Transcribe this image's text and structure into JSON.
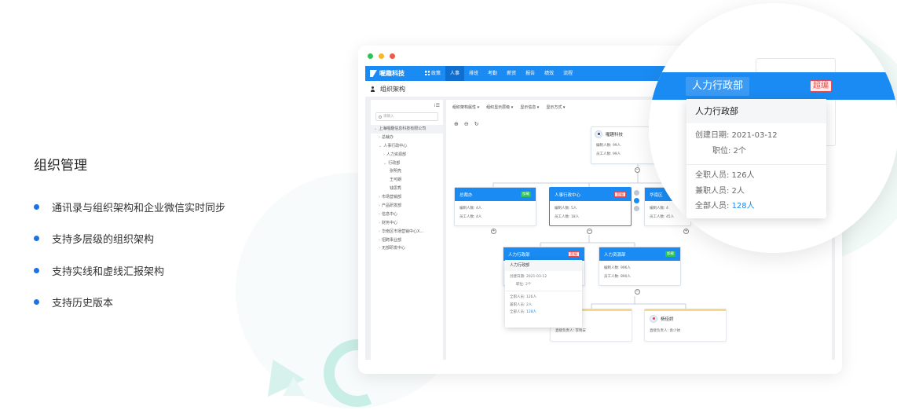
{
  "feature": {
    "title": "组织管理",
    "bullets": [
      "通讯录与组织架构和企业微信实时同步",
      "支持多层级的组织架构",
      "支持实线和虚线汇报架构",
      "支持历史版本"
    ]
  },
  "app": {
    "brand": "喔趣科技",
    "nav": [
      "政策",
      "人事",
      "排班",
      "考勤",
      "薪资",
      "报告",
      "绩效",
      "流程"
    ],
    "active_nav": "人事",
    "page_title": "组织架构",
    "search_placeholder": "请输入",
    "sidebar_toggle": "⁞☰",
    "tree": [
      {
        "label": "上海喔趣信息科技有限公司",
        "indent": 0,
        "caret": "⌄"
      },
      {
        "label": "总裁办",
        "indent": 1,
        "caret": "›"
      },
      {
        "label": "人事行政中心",
        "indent": 1,
        "caret": "⌄"
      },
      {
        "label": "人力资源部",
        "indent": 2,
        "caret": "›"
      },
      {
        "label": "行政部",
        "indent": 2,
        "caret": "⌄"
      },
      {
        "label": "张明亮",
        "indent": 3,
        "caret": ""
      },
      {
        "label": "王可朗",
        "indent": 3,
        "caret": ""
      },
      {
        "label": "钱思秀",
        "indent": 3,
        "caret": ""
      },
      {
        "label": "市场营销部",
        "indent": 1,
        "caret": "›"
      },
      {
        "label": "产品研发部",
        "indent": 1,
        "caret": "›"
      },
      {
        "label": "信息中心",
        "indent": 1,
        "caret": "›"
      },
      {
        "label": "财务中心",
        "indent": 1,
        "caret": "›"
      },
      {
        "label": "华南区市场营销中心X...",
        "indent": 1,
        "caret": "›"
      },
      {
        "label": "招聘事业部",
        "indent": 1,
        "caret": "›"
      },
      {
        "label": "无部研发中心",
        "indent": 1,
        "caret": "›"
      }
    ],
    "filters": [
      "组织架构属性 ▾",
      "组织显示层级 ▾",
      "显示信息 ▾",
      "显示方式 ▾"
    ],
    "tools": [
      "⊕",
      "⊖",
      "↻"
    ],
    "root_card": {
      "name": "喔趣科技",
      "line1": "编制人数: 99人",
      "line2": "员工人数: 99人"
    },
    "cards": [
      {
        "name": "总裁办",
        "tag": "加载",
        "line1": "编制人数: 4人",
        "line2": "员工人数: 4人"
      },
      {
        "name": "人事行政中心",
        "tag": "超编",
        "line1": "编制人数: 5人",
        "line2": "员工人数: 18人"
      },
      {
        "name": "华南区",
        "tag": "",
        "line1": "编制人数: 4",
        "line2": "员工人数: 45人"
      },
      {
        "name": "人力行政部",
        "tag": "超编",
        "line1": "",
        "line2": ""
      },
      {
        "name": "人力资源部",
        "tag": "加载",
        "line1": "编制人数: 996人",
        "line2": "员工人数: 890人"
      }
    ],
    "employees": [
      {
        "name": "",
        "lead": "直接负责人: 李晓安"
      },
      {
        "name": "杨佳娇",
        "lead": "直接负责人: 袁少帅"
      }
    ],
    "mini_popup": {
      "header": "人力行政部",
      "created": "创建日期: 2021-03-12",
      "positions": "职位: 2个",
      "fulltime": "全职人员: 126人",
      "parttime": "兼职人员: 2人",
      "total_label": "全部人员:",
      "total_value": "128人"
    }
  },
  "magnifier": {
    "department": "人力行政部",
    "tag": "超编",
    "popup": {
      "header": "人力行政部",
      "created": "创建日期: 2021-03-12",
      "positions": "职位: 2个",
      "fulltime": "全职人员: 126人",
      "parttime": "兼职人员: 2人",
      "total_label": "全部人员:",
      "total_value": "128人"
    }
  },
  "colors": {
    "brand_blue": "#1a8bf2",
    "bullet_blue": "#1a73e8",
    "alert_red": "#e84c4c",
    "ok_green": "#2fc15a"
  }
}
